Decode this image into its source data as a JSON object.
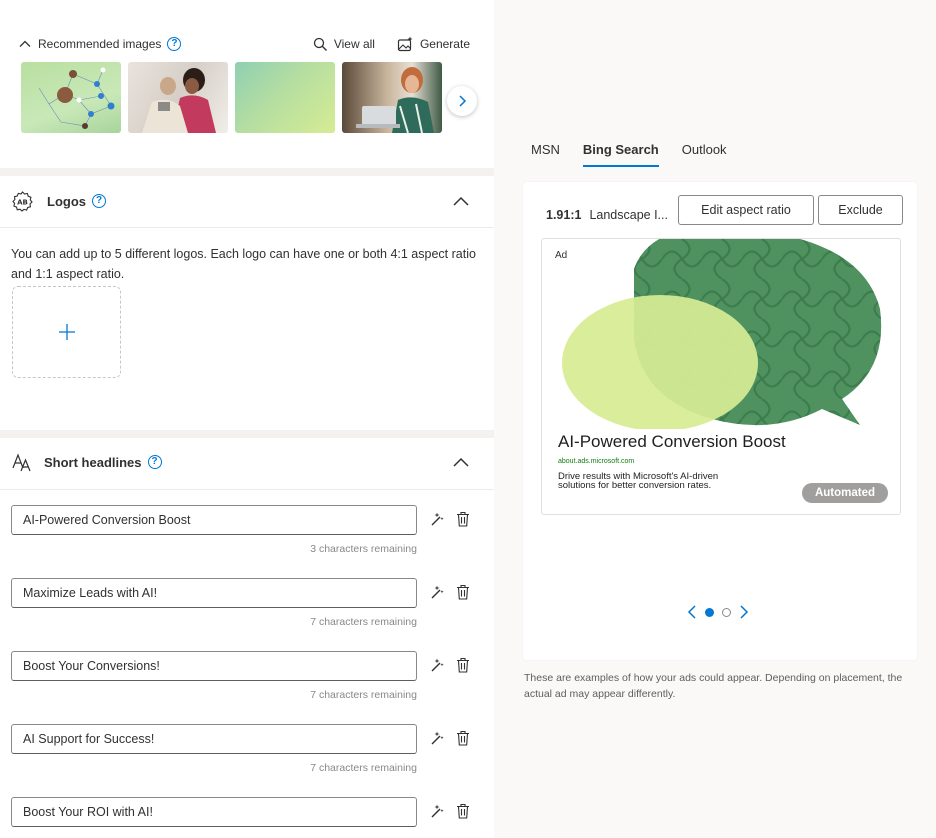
{
  "recommended": {
    "title": "Recommended images",
    "view_all": "View all",
    "generate": "Generate"
  },
  "logos": {
    "title": "Logos",
    "description": "You can add up to 5 different logos. Each logo can have one or both 4:1 aspect ratio and 1:1 aspect ratio."
  },
  "headlines": {
    "title": "Short headlines",
    "items": [
      {
        "value": "AI-Powered Conversion Boost",
        "remaining": "3 characters remaining"
      },
      {
        "value": "Maximize Leads with AI!",
        "remaining": "7 characters remaining"
      },
      {
        "value": "Boost Your Conversions!",
        "remaining": "7 characters remaining"
      },
      {
        "value": "AI Support for Success!",
        "remaining": "7 characters remaining"
      },
      {
        "value": "Boost Your ROI with AI!",
        "remaining": "7 characters remaining"
      }
    ]
  },
  "preview": {
    "tabs": [
      {
        "label": "MSN",
        "active": false
      },
      {
        "label": "Bing Search",
        "active": true
      },
      {
        "label": "Outlook",
        "active": false
      }
    ],
    "ratio": "1.91:1",
    "ratio_label": "Landscape I...",
    "edit_label": "Edit aspect ratio",
    "exclude_label": "Exclude",
    "ad": {
      "label": "Ad",
      "title": "AI-Powered Conversion Boost",
      "url": "about.ads.microsoft.com",
      "description": "Drive results with Microsoft's AI-driven solutions for better conversion rates.",
      "badge": "Automated"
    },
    "note": "These are examples of how your ads could appear. Depending on placement, the actual ad may appear differently."
  },
  "colors": {
    "accent": "#0078d4",
    "ad_green_dark": "#3f8a52",
    "ad_green_light": "#d6ec93"
  }
}
